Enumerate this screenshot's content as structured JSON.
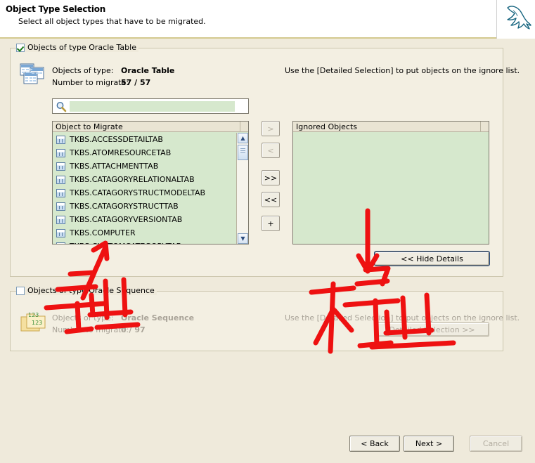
{
  "header": {
    "title": "Object Type Selection",
    "subtitle": "Select all object types that have to be migrated.",
    "logo_icon": "mysql-dolphin-logo"
  },
  "table_group": {
    "legend_label": "Objects of type Oracle Table",
    "checked": true,
    "icon": "oracle-table-icon",
    "type_label": "Objects of type:",
    "type_value": "Oracle Table",
    "count_label": "Number to migrate:",
    "count_value": "57 / 57",
    "hint": "Use the [Detailed Selection] to put objects on the ignore list.",
    "search": {
      "value": "",
      "placeholder": "",
      "icon": "search-icon"
    },
    "left_list": {
      "header": "Object to Migrate",
      "items": [
        "TKBS.ACCESSDETAILTAB",
        "TKBS.ATOMRESOURCETAB",
        "TKBS.ATTACHMENTTAB",
        "TKBS.CATAGORYRELATIONALTAB",
        "TKBS.CATAGORYSTRUCTMODELTAB",
        "TKBS.CATAGORYSTRUCTTAB",
        "TKBS.CATAGORYVERSIONTAB",
        "TKBS.COMPUTER",
        "TKBS.CUSTOMCATEGORYTAB"
      ]
    },
    "right_list": {
      "header": "Ignored Objects",
      "items": []
    },
    "transfer_buttons": [
      {
        "label": ">",
        "name": "move-right-button",
        "disabled": true
      },
      {
        "label": "<",
        "name": "move-left-button",
        "disabled": true
      },
      {
        "label": ">>",
        "name": "move-all-right-button",
        "disabled": false
      },
      {
        "label": "<<",
        "name": "move-all-left-button",
        "disabled": false
      },
      {
        "label": "+",
        "name": "add-button",
        "disabled": false
      }
    ],
    "hide_details_label": "<< Hide Details"
  },
  "sequence_group": {
    "legend_label": "Objects of type Oracle Sequence",
    "checked": false,
    "icon": "oracle-sequence-icon",
    "type_label": "Objects of type:",
    "type_value": "Oracle Sequence",
    "count_label": "Number to migrate:",
    "count_value": "0 / 97",
    "hint": "Use the [Detailed Selection] to put objects on the ignore list.",
    "detailed_selection_label": "Detailed Selection >>"
  },
  "footer": {
    "back_label": "< Back",
    "next_label": "Next >",
    "cancel_label": "Cancel",
    "cancel_disabled": true
  },
  "annotations": {
    "color": "#ee1111",
    "marks": [
      {
        "name": "annotation-arrow-to-table-list",
        "text": ""
      },
      {
        "name": "annotation-export-chinese",
        "text": "导出"
      },
      {
        "name": "annotation-arrow-to-sequence",
        "text": ""
      },
      {
        "name": "annotation-no-export-chinese",
        "text": "不导出"
      }
    ]
  }
}
